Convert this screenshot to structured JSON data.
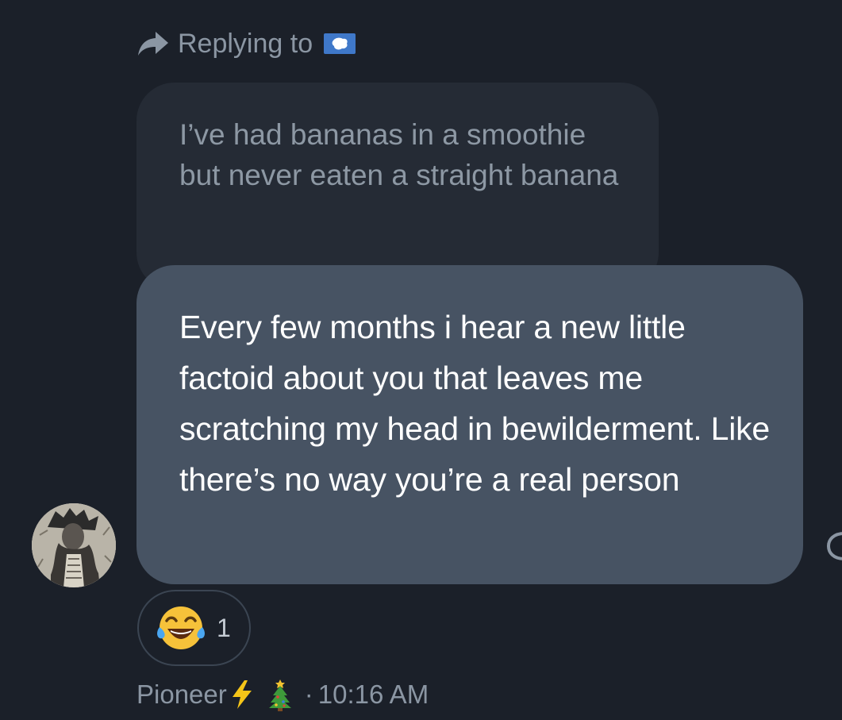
{
  "reply_header": {
    "label": "Replying to",
    "flag_icon": "antarctica-flag-icon",
    "arrow_icon": "reply-arrow-icon"
  },
  "quoted_message": {
    "text": "I’ve had bananas in a smoothie but never eaten a straight banana"
  },
  "message": {
    "text": "Every few months i hear a new little factoid about you that leaves me scratching my head in bewilderment. Like there’s no way you’re a real person"
  },
  "reaction": {
    "emoji": "face-with-tears-of-joy-icon",
    "count": "1"
  },
  "meta": {
    "sender": "Pioneer",
    "badges": [
      "lightning-bolt-icon",
      "christmas-tree-icon"
    ],
    "separator": "·",
    "time": "10:16 AM"
  },
  "colors": {
    "background": "#1b2029",
    "quoted_bubble": "#252b35",
    "message_bubble": "#475363",
    "muted_text": "#8b96a3"
  }
}
